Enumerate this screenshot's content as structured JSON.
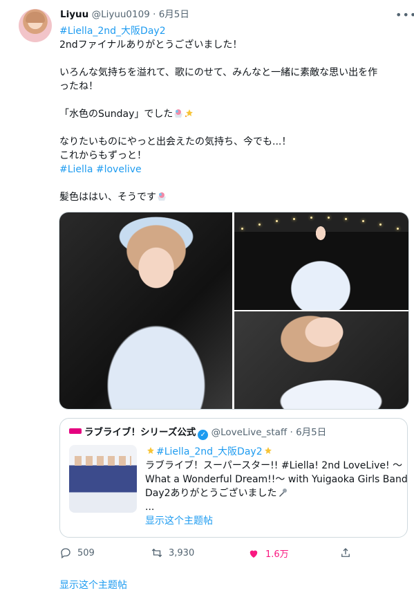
{
  "tweet": {
    "author_name": "Liyuu",
    "author_handle": "@Liyuu0109",
    "separator": "·",
    "date": "6月5日",
    "hashtag_top": "#Liella_2nd_大阪Day2",
    "line1": "2ndファイナルありがとうございました！",
    "line2a": "いろんな気持ちを溢れて、歌にのせて、みんなと一緒に素敵な思い出を作",
    "line2b": "ったね！",
    "line3": "「水色のSunday」でした",
    "line4a": "なりたいものにやっと出会えたの気持ち、今でも...！",
    "line4b": "これからもずっと！",
    "tag1": "#Liella",
    "tag2": "#lovelive",
    "line5": "髪色ははい、そうです"
  },
  "quote": {
    "author_name": "ラブライブ！シリーズ公式",
    "author_handle": "@LoveLive_staff",
    "separator": "·",
    "date": "6月5日",
    "hashtag": "#Liella_2nd_大阪Day2",
    "line1": "ラブライブ！スーパースター!! #Liella! 2nd LoveLive! 〜",
    "line2": "What a Wonderful Dream!!〜 with Yuigaoka Girls Band",
    "line3": "Day2ありがとうございました",
    "ellipsis": "...",
    "show_thread": "显示这个主题帖"
  },
  "actions": {
    "reply_count": "509",
    "retweet_count": "3,930",
    "like_count": "1.6万"
  },
  "colors": {
    "link": "#1d9bf0",
    "like": "#f91880",
    "muted": "#536471"
  },
  "show_thread": "显示这个主题帖"
}
